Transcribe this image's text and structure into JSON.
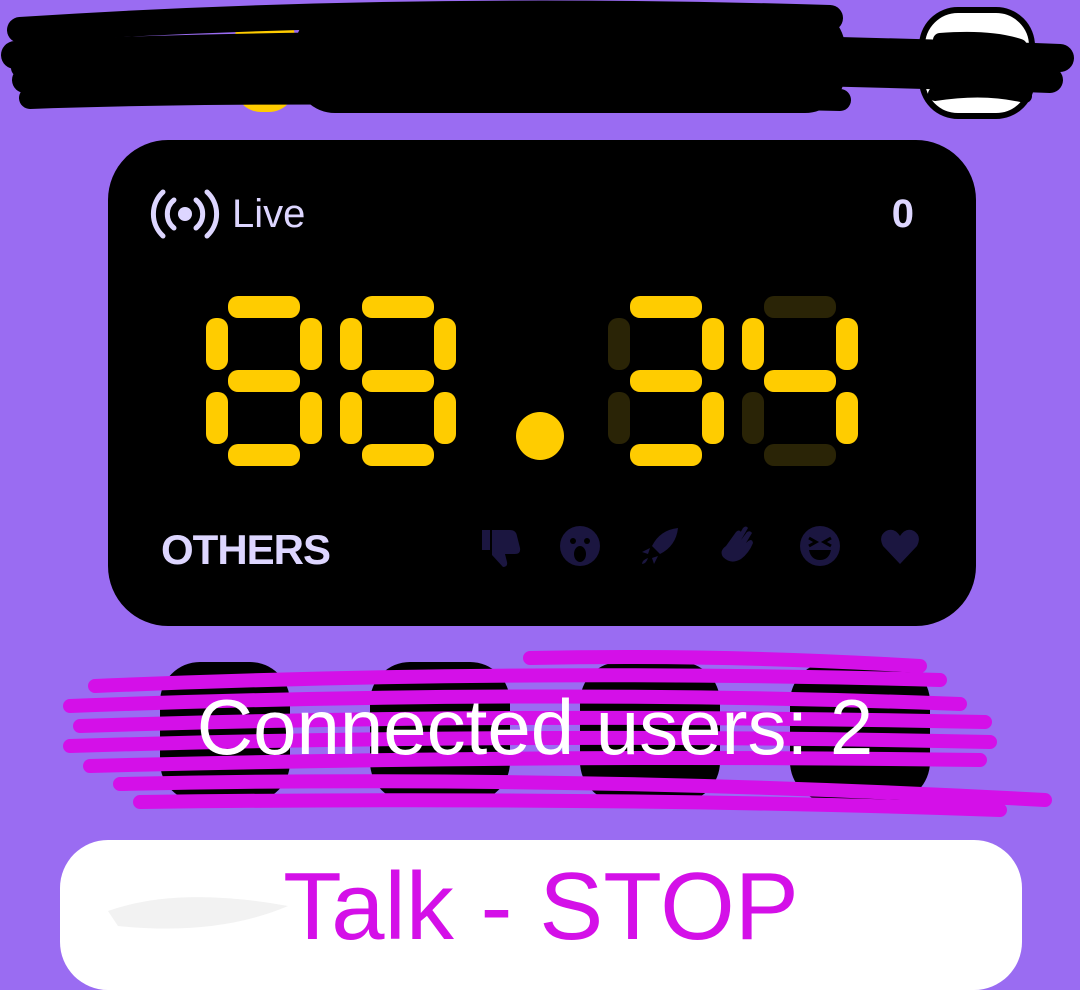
{
  "header": {
    "redacted": true
  },
  "display": {
    "live_label": "Live",
    "live_icon": "broadcast-icon",
    "count": "0",
    "digits": [
      "8",
      "8",
      ".",
      "3",
      "4"
    ],
    "category": "OTHERS",
    "reactions": [
      "thumbs-down-icon",
      "surprised-face-icon",
      "rocket-icon",
      "clapping-hands-icon",
      "laughing-face-icon",
      "heart-icon"
    ],
    "colors": {
      "segment_on": "#ffcc00",
      "segment_off": "#2a2406",
      "text": "#ddd6ff",
      "reaction": "#1b1640"
    }
  },
  "status": {
    "connected_users": "Connected users: 2"
  },
  "talk": {
    "label": "Talk - STOP"
  },
  "colors": {
    "background": "#9a6cf2",
    "scribble": "#d410e8",
    "talk_text": "#d410e8"
  }
}
